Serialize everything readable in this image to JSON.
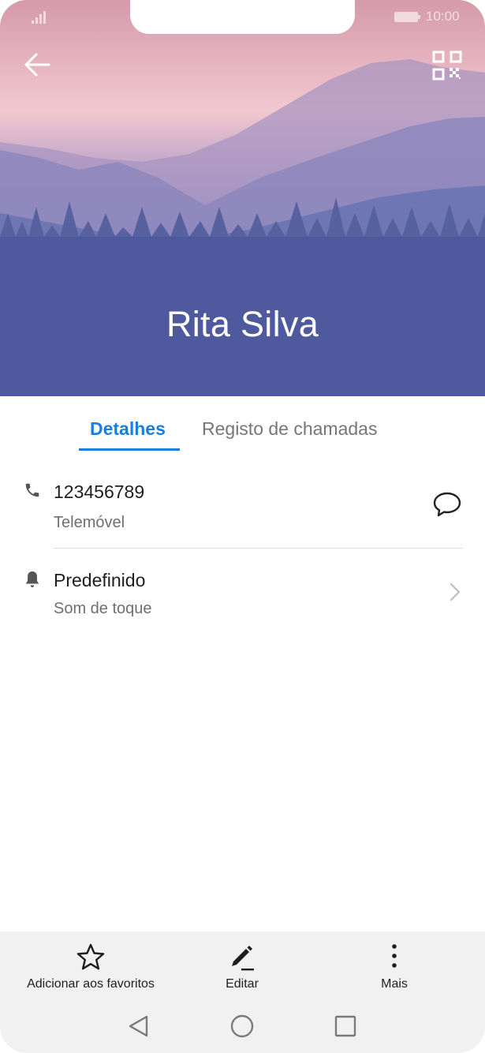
{
  "status_bar": {
    "time": "10:00"
  },
  "contact": {
    "name": "Rita Silva"
  },
  "tabs": [
    {
      "label": "Detalhes",
      "active": true
    },
    {
      "label": "Registo de chamadas",
      "active": false
    }
  ],
  "details": {
    "phone": {
      "number": "123456789",
      "type": "Telemóvel",
      "icon": "phone-icon",
      "action_icon": "message-icon"
    },
    "ringtone": {
      "value": "Predefinido",
      "label": "Som de toque",
      "icon": "bell-icon"
    }
  },
  "actions": [
    {
      "label": "Adicionar aos favoritos",
      "icon": "star-icon"
    },
    {
      "label": "Editar",
      "icon": "pencil-icon"
    },
    {
      "label": "Mais",
      "icon": "more-vertical-icon"
    }
  ],
  "colors": {
    "accent": "#1a7ee1",
    "bottom_bar": "#f1f1f1"
  }
}
